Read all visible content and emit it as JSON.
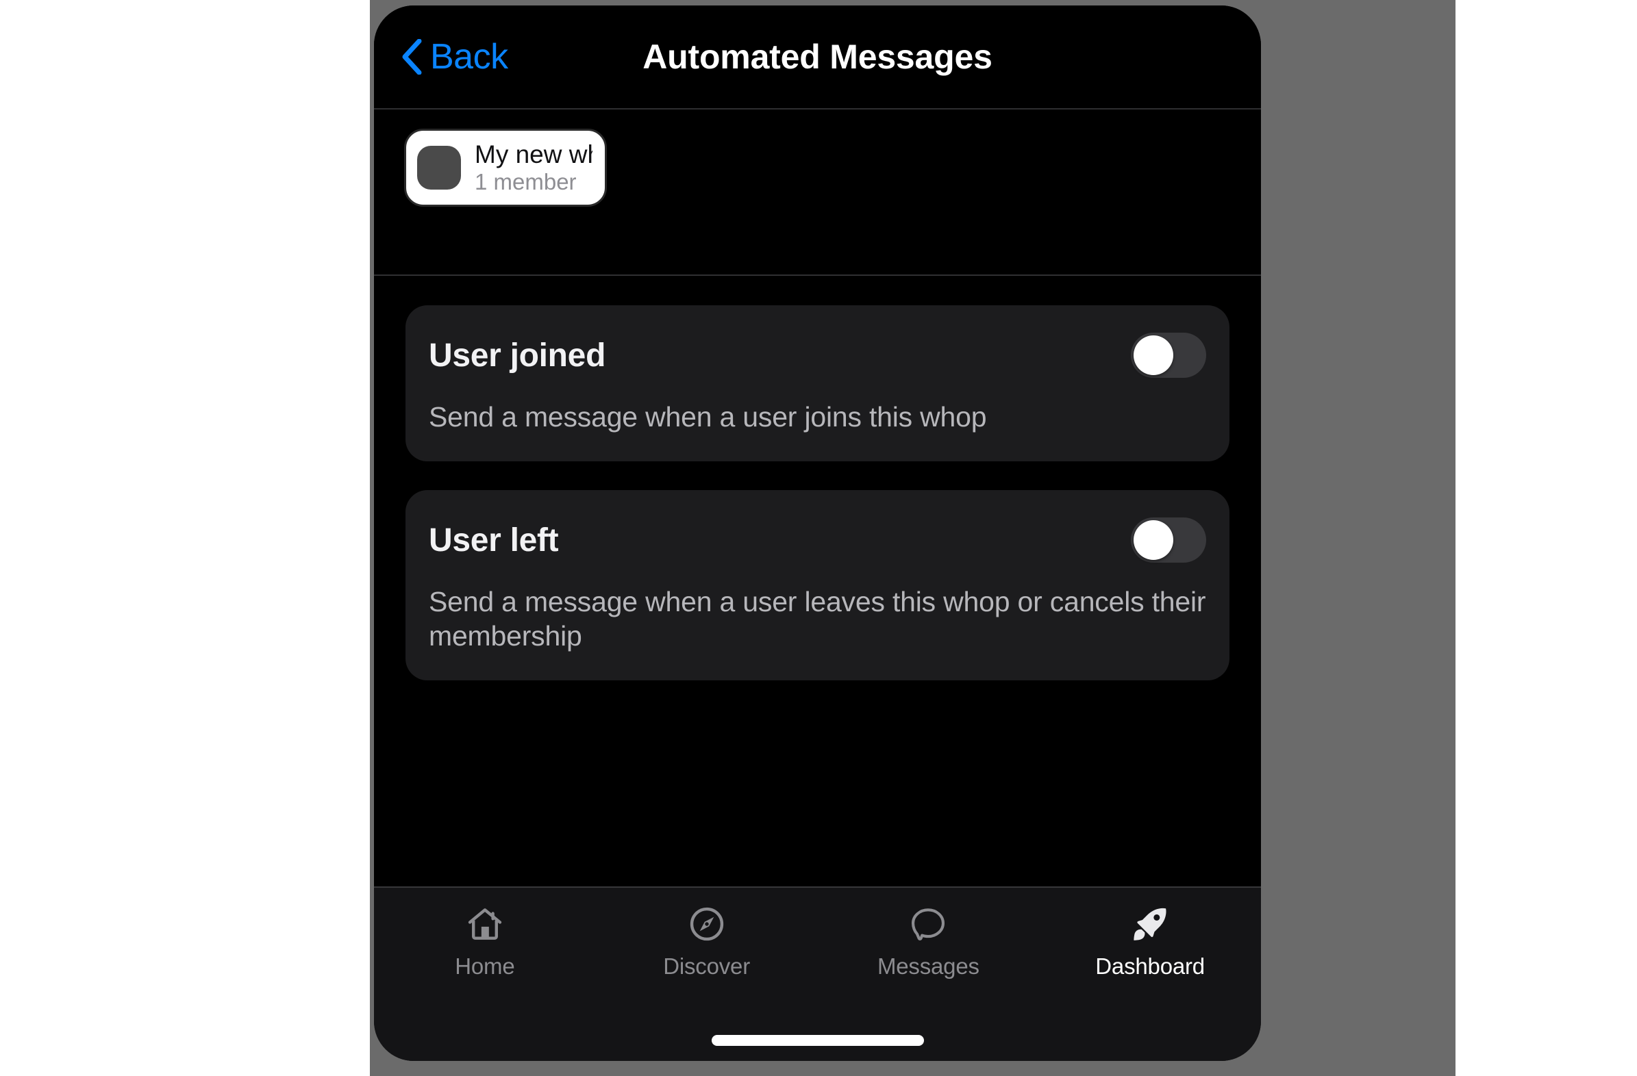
{
  "header": {
    "back_label": "Back",
    "back_icon": "chevron-left-icon",
    "title": "Automated Messages"
  },
  "whop_chip": {
    "name": "My new whop",
    "members": "1 member",
    "avatar_icon": "whop-avatar-placeholder"
  },
  "settings": [
    {
      "title": "User joined",
      "description": "Send a message when a user joins this whop",
      "toggle_on": false
    },
    {
      "title": "User left",
      "description": "Send a message when a user leaves this whop or cancels their membership",
      "toggle_on": false
    }
  ],
  "tab_bar": {
    "items": [
      {
        "label": "Home",
        "icon": "home-icon",
        "active": false
      },
      {
        "label": "Discover",
        "icon": "compass-icon",
        "active": false
      },
      {
        "label": "Messages",
        "icon": "chat-bubble-icon",
        "active": false
      },
      {
        "label": "Dashboard",
        "icon": "rocket-icon",
        "active": true
      }
    ]
  },
  "colors": {
    "accent_blue": "#0a84ff",
    "screen_bg": "#000000",
    "card_bg": "#1c1c1e",
    "toggle_track_off": "#39393c",
    "toggle_knob": "#ffffff",
    "tab_inactive": "#8c8c90",
    "tab_active": "#ffffff",
    "backdrop_gray": "#6b6b6b"
  }
}
